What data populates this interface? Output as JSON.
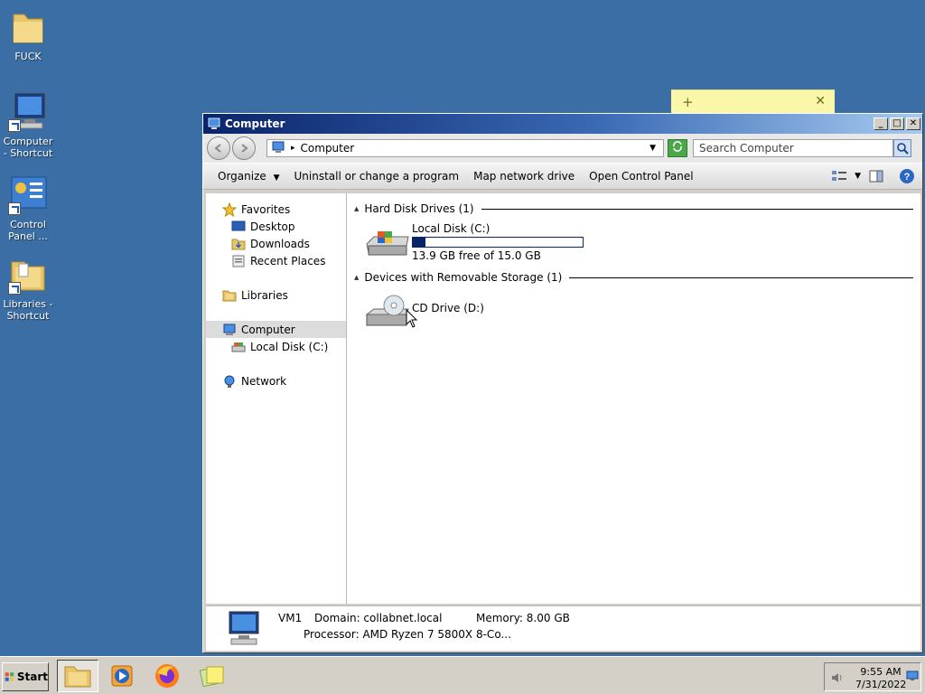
{
  "desktop": {
    "icons": [
      {
        "label": "FUCK",
        "icon": "folder-icon"
      },
      {
        "label": "Computer - Shortcut",
        "icon": "computer-icon"
      },
      {
        "label": "Control Panel ...",
        "icon": "control-panel-icon"
      },
      {
        "label": "Libraries - Shortcut",
        "icon": "libraries-icon"
      }
    ]
  },
  "sticky": {
    "add": "+",
    "close": "✕"
  },
  "window": {
    "title": "Computer",
    "controls": {
      "minimize": "_",
      "maximize": "□",
      "close": "✕"
    },
    "address": {
      "path": "Computer",
      "separator": "▸"
    },
    "search": {
      "placeholder": "Search Computer"
    },
    "toolbar": {
      "organize": "Organize",
      "uninstall": "Uninstall or change a program",
      "map_drive": "Map network drive",
      "control_panel": "Open Control Panel"
    },
    "nav": {
      "favorites": "Favorites",
      "desktop": "Desktop",
      "downloads": "Downloads",
      "recent": "Recent Places",
      "libraries": "Libraries",
      "computer": "Computer",
      "local_disk": "Local Disk (C:)",
      "network": "Network"
    },
    "groups": {
      "hard_disks": "Hard Disk Drives (1)",
      "removable": "Devices with Removable Storage (1)"
    },
    "drives": {
      "c": {
        "name": "Local Disk (C:)",
        "free": "13.9 GB free of 15.0 GB",
        "used_fraction": 0.073
      },
      "d": {
        "name": "CD Drive (D:)"
      }
    },
    "details": {
      "name": "VM1",
      "domain": "Domain: collabnet.local",
      "memory": "Memory: 8.00 GB",
      "processor": "Processor: AMD Ryzen 7 5800X 8-Co..."
    }
  },
  "taskbar": {
    "start": "Start",
    "time": "9:55 AM",
    "date": "7/31/2022"
  }
}
